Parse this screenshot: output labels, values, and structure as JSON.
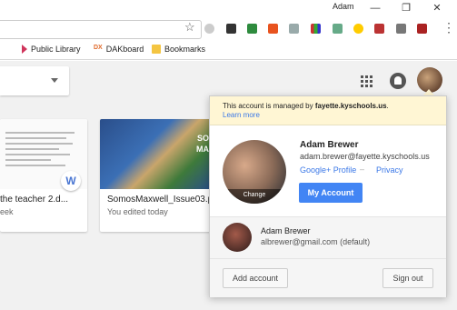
{
  "titlebar": {
    "user": "Adam",
    "minimize": "—",
    "restore": "❐",
    "close": "✕"
  },
  "toolbar": {
    "star": "☆",
    "menu": "⋮"
  },
  "bookmarks": [
    {
      "label": "Public Library",
      "icon": "public-library-icon",
      "color": "#d0355c"
    },
    {
      "label": "DAKboard",
      "icon": "dakboard-icon",
      "color": "#e06a2a"
    },
    {
      "label": "Bookmarks",
      "icon": "folder-icon",
      "color": "#f4c542"
    }
  ],
  "cards": [
    {
      "title": "the teacher 2.d...",
      "subtitle": "eek",
      "badge": "W"
    },
    {
      "title": "SomosMaxwell_Issue03.p",
      "subtitle": "You edited today",
      "thumb_text": "SO",
      "thumb_text2": "MA"
    }
  ],
  "popup": {
    "managed_prefix": "This account is managed by ",
    "managed_domain": "fayette.kyschools.us",
    "managed_suffix": ".",
    "learn_more": "Learn more",
    "change": "Change",
    "name": "Adam Brewer",
    "email": "adam.brewer@fayette.kyschools.us",
    "gplus": "Google+ Profile",
    "separator": "–",
    "privacy": "Privacy",
    "my_account": "My Account",
    "other_name": "Adam Brewer",
    "other_email": "albrewer@gmail.com (default)",
    "add_account": "Add account",
    "sign_out": "Sign out"
  },
  "colors": {
    "accent": "#4285f4",
    "link": "#3b78e7",
    "managed_bg": "#fff6d4"
  }
}
